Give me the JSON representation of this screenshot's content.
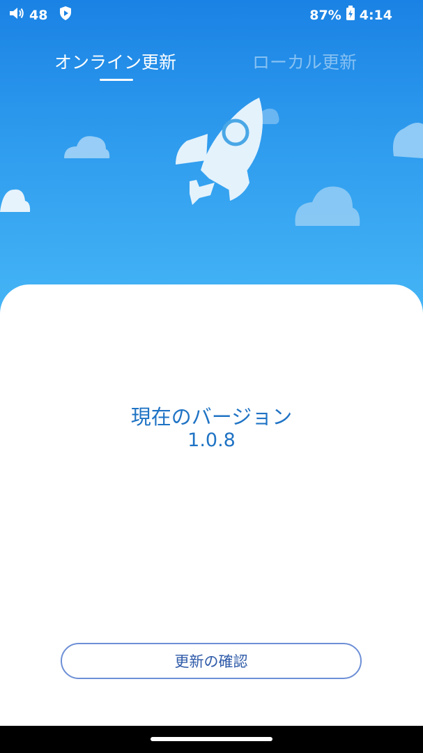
{
  "status_bar": {
    "volume_level": "48",
    "battery_percent": "87%",
    "time": "4:14",
    "icons": [
      "volume-icon",
      "shield-icon",
      "battery-icon"
    ]
  },
  "tabs": [
    {
      "label": "オンライン更新",
      "active": true
    },
    {
      "label": "ローカル更新",
      "active": false
    }
  ],
  "illustration": {
    "icons": [
      "rocket-icon",
      "cloud-icon"
    ],
    "colors": {
      "sky_top": "#1a82e4",
      "sky_bottom": "#46b6f6",
      "rocket": "#e4f2fc",
      "cloud": "#a9d6f7"
    }
  },
  "version": {
    "label": "現在のバージョン",
    "number": "1.0.8"
  },
  "actions": {
    "check_update_label": "更新の確認"
  },
  "colors": {
    "accent_text": "#1f73c4",
    "button_border": "#6d8fd6"
  }
}
